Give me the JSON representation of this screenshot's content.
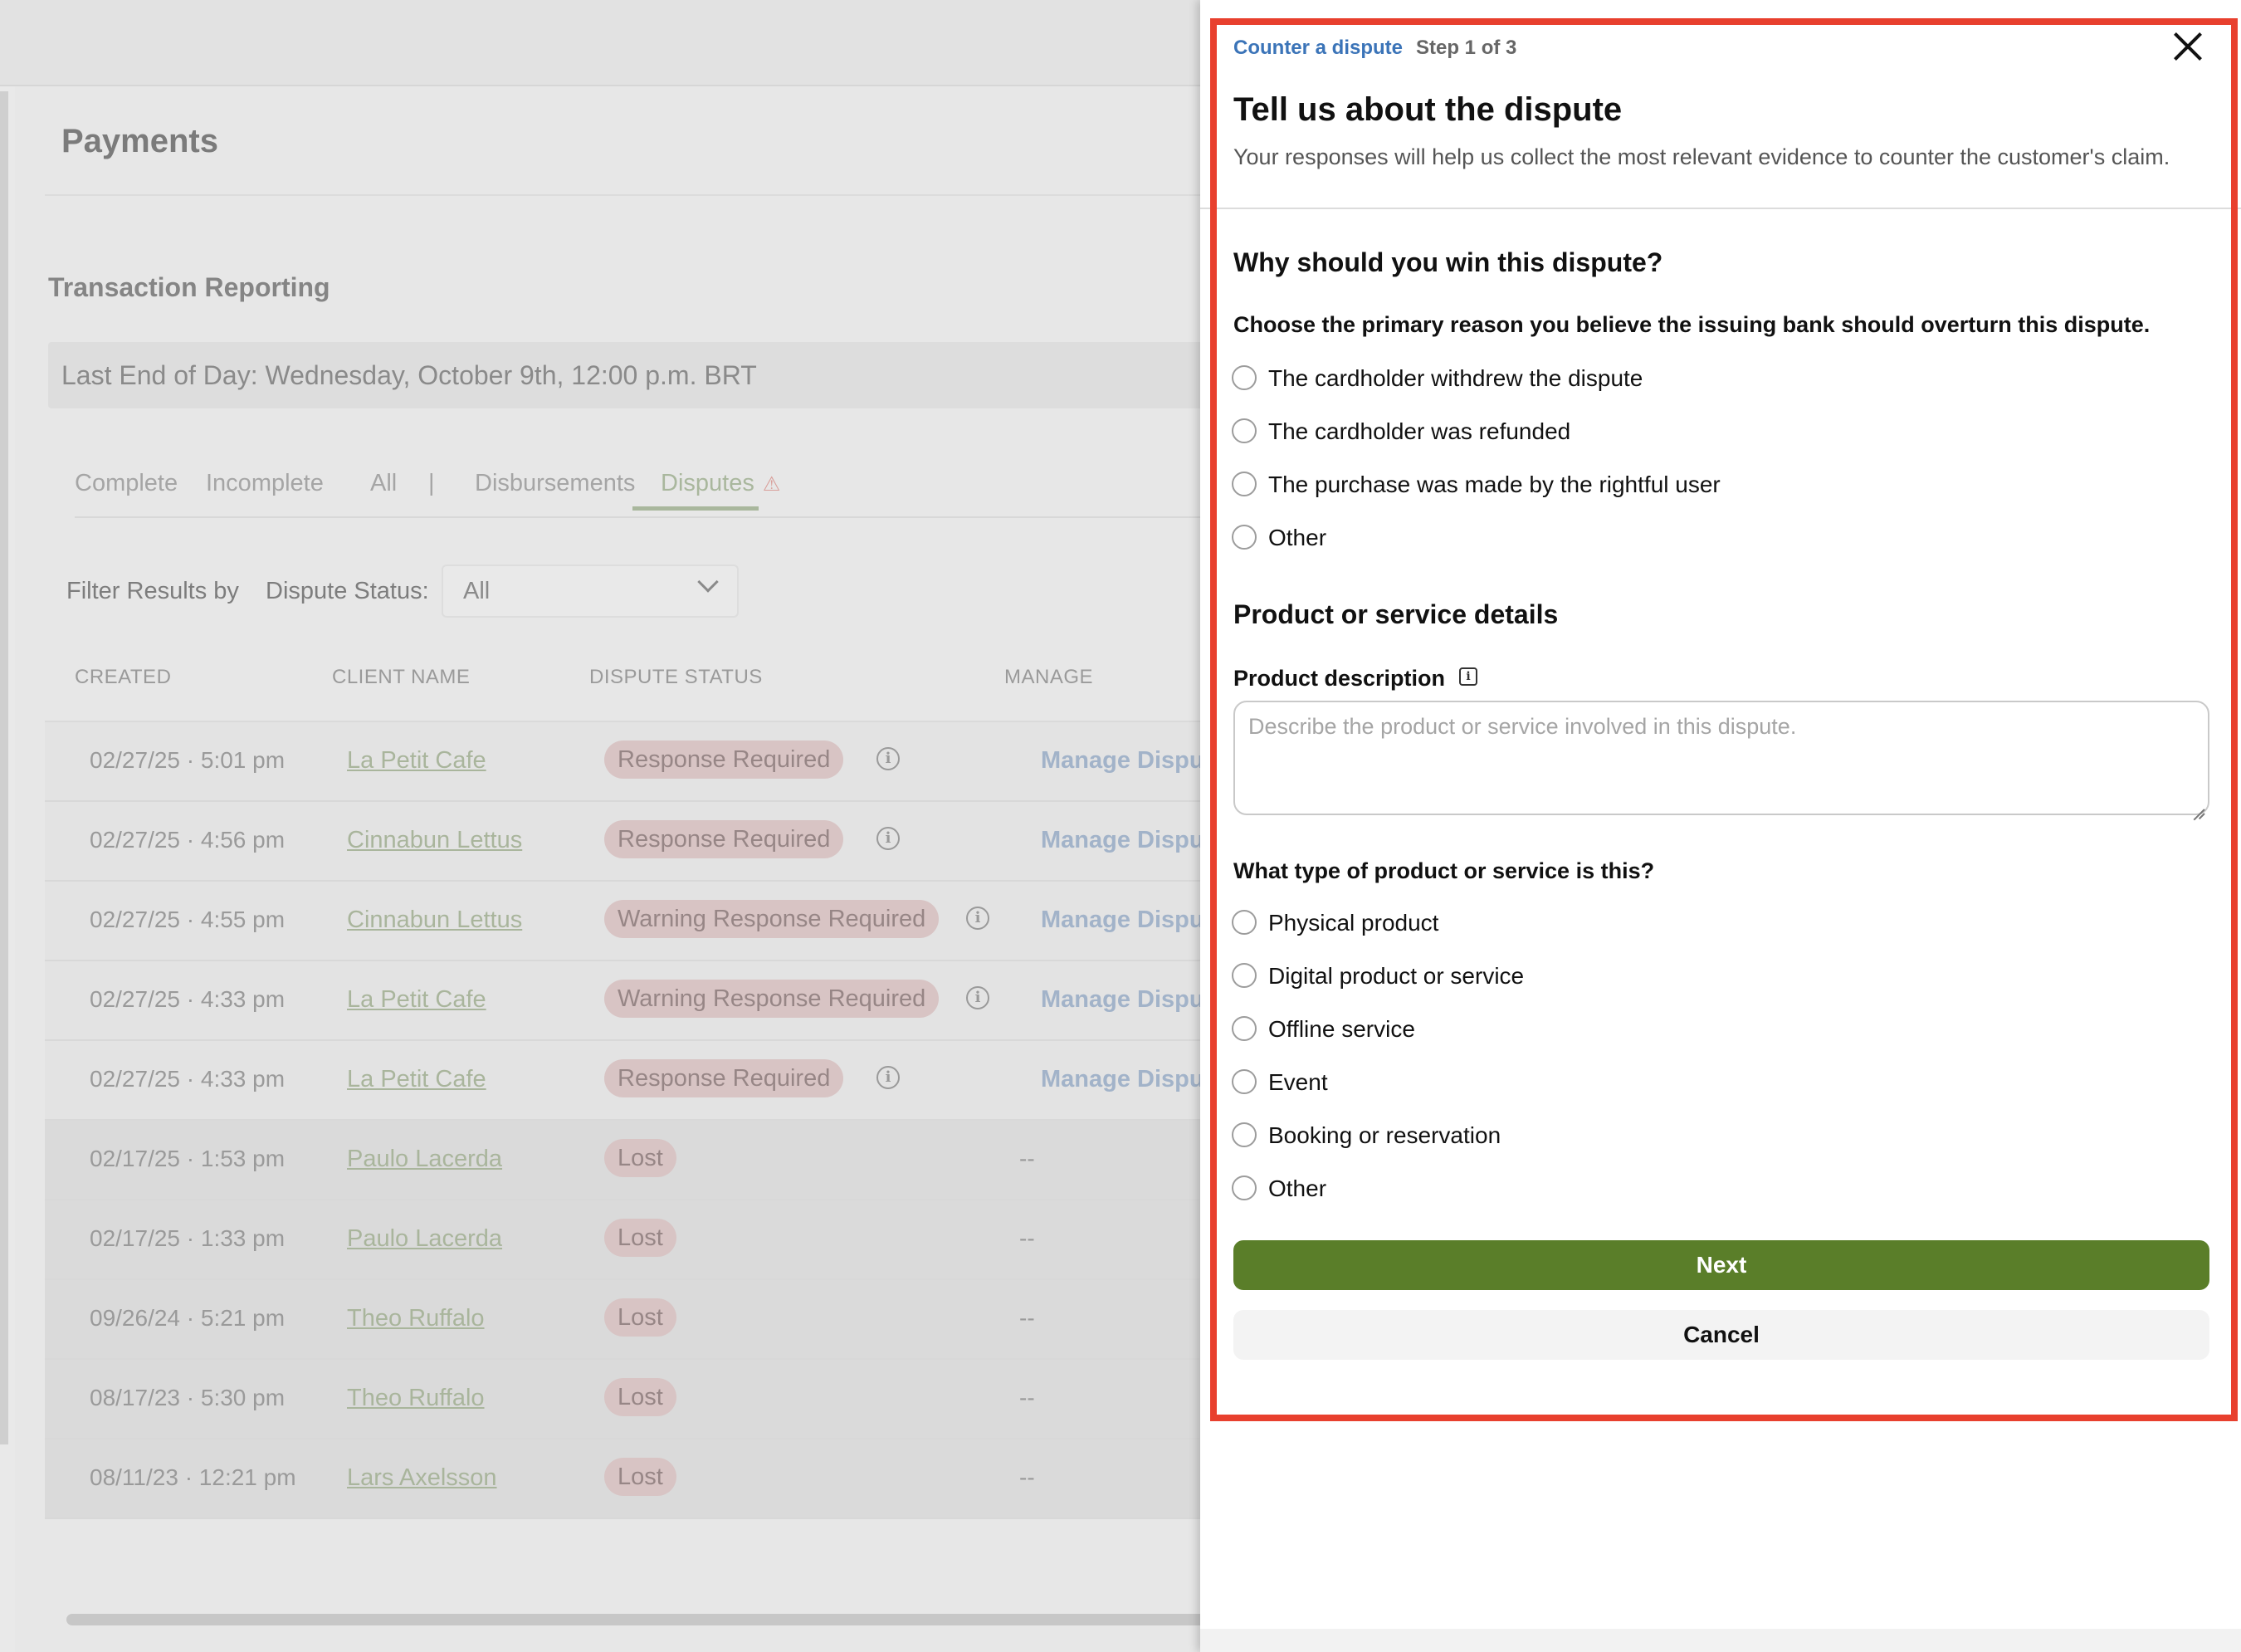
{
  "background": {
    "page_title": "Payments",
    "section_title": "Transaction Reporting",
    "end_of_day": "Last End of Day: Wednesday, October 9th, 12:00 p.m. BRT",
    "tabs": {
      "complete": "Complete",
      "incomplete": "Incomplete",
      "all": "All",
      "separator": "|",
      "disbursements": "Disbursements",
      "disputes": "Disputes",
      "disputes_icon": "warning-icon"
    },
    "filter": {
      "label": "Filter Results by",
      "status_label": "Dispute Status:",
      "selected": "All"
    },
    "columns": [
      "CREATED",
      "CLIENT NAME",
      "DISPUTE STATUS",
      "MANAGE"
    ],
    "rows": [
      {
        "created": "02/27/25 · 5:01 pm",
        "client": "La Petit Cafe",
        "status": "Response Required",
        "manage": "Manage Dispute"
      },
      {
        "created": "02/27/25 · 4:56 pm",
        "client": "Cinnabun Lettus",
        "status": "Response Required",
        "manage": "Manage Dispute"
      },
      {
        "created": "02/27/25 · 4:55 pm",
        "client": "Cinnabun Lettus",
        "status": "Warning Response Required",
        "manage": "Manage Dispute"
      },
      {
        "created": "02/27/25 · 4:33 pm",
        "client": "La Petit Cafe",
        "status": "Warning Response Required",
        "manage": "Manage Dispute"
      },
      {
        "created": "02/27/25 · 4:33 pm",
        "client": "La Petit Cafe",
        "status": "Response Required",
        "manage": "Manage Dispute"
      },
      {
        "created": "02/17/25 · 1:53 pm",
        "client": "Paulo Lacerda",
        "status": "Lost",
        "manage": "--"
      },
      {
        "created": "02/17/25 · 1:33 pm",
        "client": "Paulo Lacerda",
        "status": "Lost",
        "manage": "--"
      },
      {
        "created": "09/26/24 · 5:21 pm",
        "client": "Theo Ruffalo",
        "status": "Lost",
        "manage": "--"
      },
      {
        "created": "08/17/23 · 5:30 pm",
        "client": "Theo Ruffalo",
        "status": "Lost",
        "manage": "--"
      },
      {
        "created": "08/11/23 · 12:21 pm",
        "client": "Lars Axelsson",
        "status": "Lost",
        "manage": "--"
      }
    ]
  },
  "panel": {
    "step_label": "Counter a dispute",
    "step_count": "Step 1 of 3",
    "heading": "Tell us about the dispute",
    "subheading": "Your responses will help us collect the most relevant evidence to counter the customer's claim.",
    "q1": {
      "title": "Why should you win this dispute?",
      "prompt": "Choose the primary reason you believe the issuing bank should overturn this dispute.",
      "options": [
        "The cardholder withdrew the dispute",
        "The cardholder was refunded",
        "The purchase was made by the rightful user",
        "Other"
      ]
    },
    "q2": {
      "title": "Product or service details",
      "description_label": "Product description",
      "description_placeholder": "Describe the product or service involved in this dispute.",
      "type_prompt": "What type of product or service is this?",
      "options": [
        "Physical product",
        "Digital product or service",
        "Offline service",
        "Event",
        "Booking or reservation",
        "Other"
      ]
    },
    "next_label": "Next",
    "cancel_label": "Cancel"
  },
  "colors": {
    "highlight_border": "#e8402e",
    "next_button": "#5a7e29",
    "step_label": "#3b74b8"
  }
}
